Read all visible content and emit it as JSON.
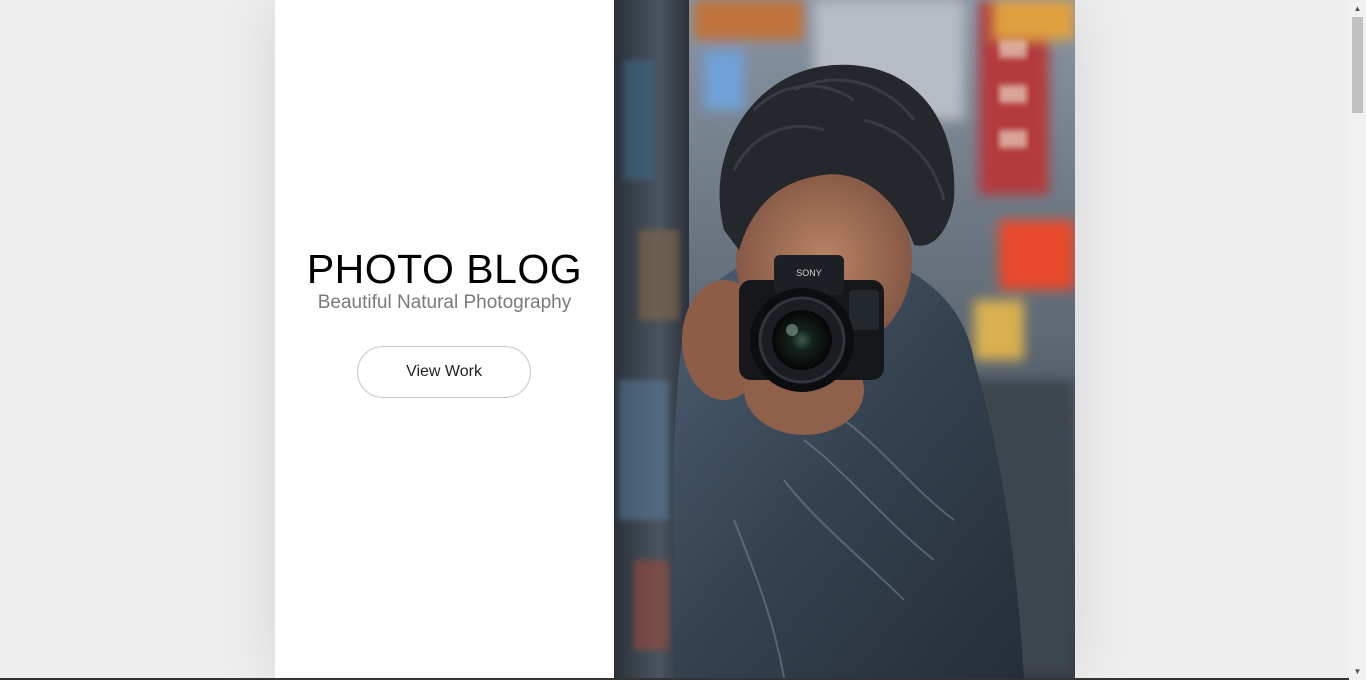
{
  "hero": {
    "title": "PHOTO BLOG",
    "subtitle": "Beautiful Natural Photography",
    "button_label": "View Work"
  },
  "photo": {
    "alt_subject": "photographer holding a camera",
    "camera_brand": "SONY"
  },
  "colors": {
    "page_background": "#eeeeee",
    "panel_background": "#ffffff",
    "title": "#000000",
    "subtitle": "#7a7a7a",
    "button_border": "#c7c7c7"
  },
  "icons": {
    "scroll_up": "triangle-up-icon",
    "scroll_down": "triangle-down-icon"
  }
}
